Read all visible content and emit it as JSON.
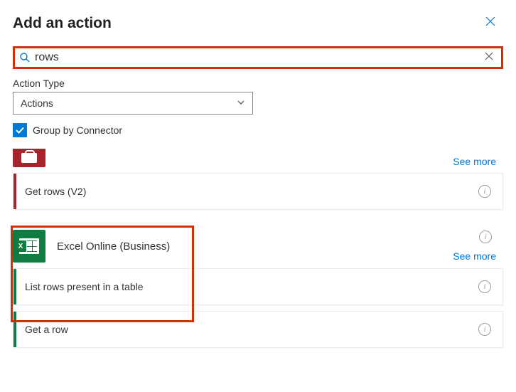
{
  "header": {
    "title": "Add an action"
  },
  "search": {
    "value": "rows"
  },
  "action_type": {
    "label": "Action Type",
    "selected": "Actions"
  },
  "group_by": {
    "label": "Group by Connector",
    "checked": true
  },
  "see_more": "See more",
  "groups": {
    "sql": {
      "actions": {
        "get_rows": "Get rows (V2)"
      }
    },
    "excel": {
      "name": "Excel Online (Business)",
      "actions": {
        "list_rows": "List rows present in a table",
        "get_a_row": "Get a row"
      }
    }
  }
}
